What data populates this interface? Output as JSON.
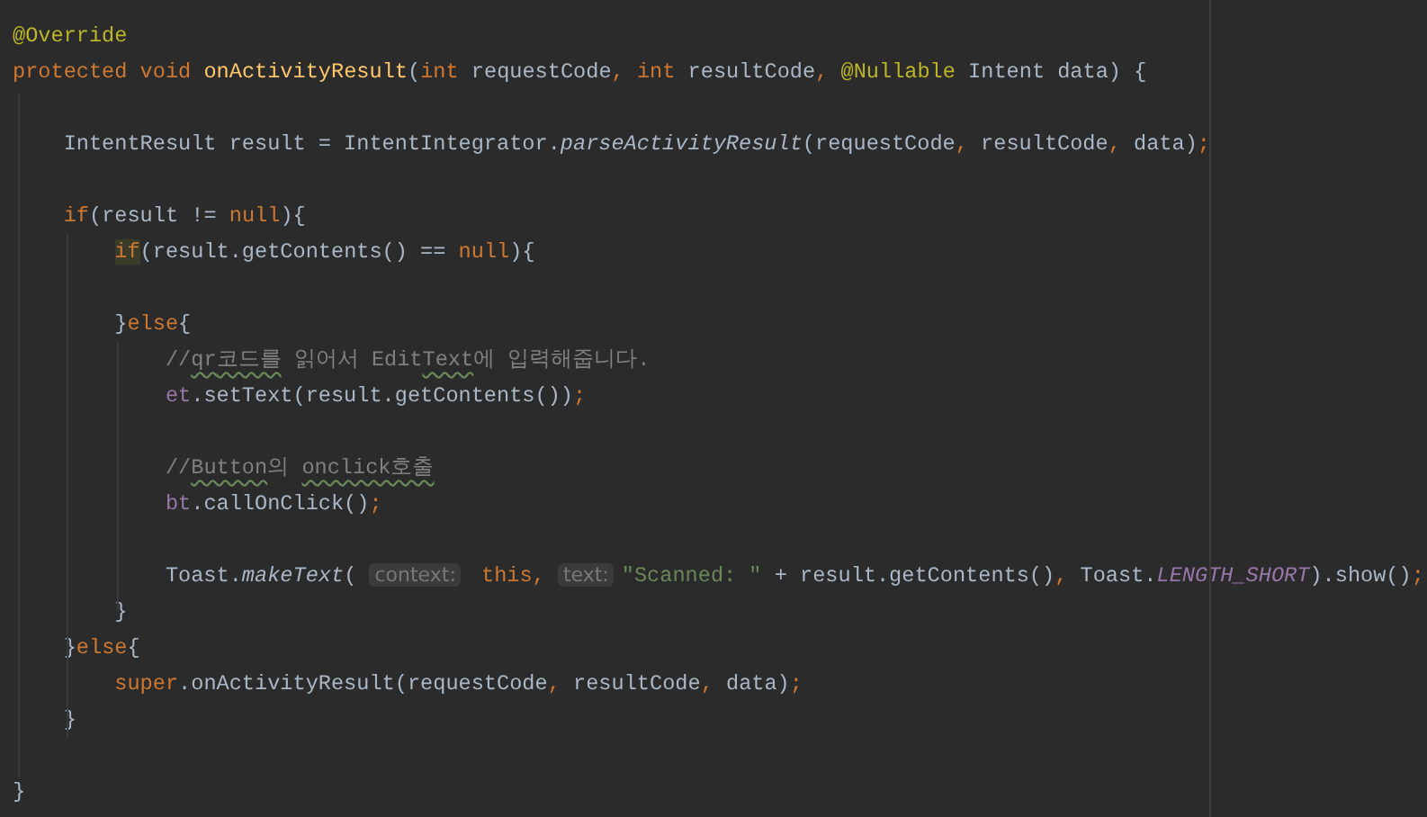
{
  "editor": {
    "lines": [
      {
        "kind": "code",
        "tokens": [
          {
            "t": "@Override",
            "kind": "annotation"
          }
        ]
      },
      {
        "kind": "code",
        "tokens": [
          {
            "t": "protected void ",
            "kind": "keyword"
          },
          {
            "t": "onActivityResult",
            "kind": "declaration"
          },
          {
            "t": "(",
            "kind": "plain"
          },
          {
            "t": "int ",
            "kind": "keyword"
          },
          {
            "t": "requestCode",
            "kind": "plain"
          },
          {
            "t": ", ",
            "kind": "keyword"
          },
          {
            "t": "int ",
            "kind": "keyword"
          },
          {
            "t": "resultCode",
            "kind": "plain"
          },
          {
            "t": ", ",
            "kind": "keyword"
          },
          {
            "t": "@Nullable ",
            "kind": "annotation"
          },
          {
            "t": "Intent data) {",
            "kind": "plain"
          }
        ],
        "children": [
          {
            "kind": "blank"
          },
          {
            "kind": "code",
            "tokens": [
              {
                "t": "IntentResult result = IntentIntegrator.",
                "kind": "plain"
              },
              {
                "t": "parseActivityResult",
                "kind": "static-method"
              },
              {
                "t": "(requestCode",
                "kind": "plain"
              },
              {
                "t": ", ",
                "kind": "keyword"
              },
              {
                "t": "resultCode",
                "kind": "plain"
              },
              {
                "t": ", ",
                "kind": "keyword"
              },
              {
                "t": "data)",
                "kind": "plain"
              },
              {
                "t": ";",
                "kind": "keyword"
              }
            ]
          },
          {
            "kind": "blank"
          },
          {
            "kind": "code",
            "tokens": [
              {
                "t": "if",
                "kind": "keyword"
              },
              {
                "t": "(result != ",
                "kind": "plain"
              },
              {
                "t": "null",
                "kind": "keyword"
              },
              {
                "t": "){",
                "kind": "plain"
              }
            ],
            "children": [
              {
                "kind": "code",
                "tokens": [
                  {
                    "t": "if",
                    "kind": "keyword-match"
                  },
                  {
                    "t": "(result.getContents() == ",
                    "kind": "plain"
                  },
                  {
                    "t": "null",
                    "kind": "keyword"
                  },
                  {
                    "t": "){",
                    "kind": "plain"
                  }
                ],
                "children": [
                  {
                    "kind": "blank"
                  }
                ]
              },
              {
                "kind": "code",
                "tokens": [
                  {
                    "t": "}",
                    "kind": "plain"
                  },
                  {
                    "t": "else",
                    "kind": "keyword"
                  },
                  {
                    "t": "{",
                    "kind": "plain"
                  }
                ],
                "children": [
                  {
                    "kind": "code",
                    "tokens": [
                      {
                        "t": "//",
                        "kind": "comment"
                      },
                      {
                        "t": "qr",
                        "kind": "comment-typo"
                      },
                      {
                        "t": "코드를",
                        "kind": "comment-typo"
                      },
                      {
                        "t": " 읽어서 Edit",
                        "kind": "comment"
                      },
                      {
                        "t": "Text",
                        "kind": "comment-typo"
                      },
                      {
                        "t": "에 입력해줍니다.",
                        "kind": "comment"
                      }
                    ]
                  },
                  {
                    "kind": "code",
                    "tokens": [
                      {
                        "t": "et",
                        "kind": "field"
                      },
                      {
                        "t": ".setText(result.getContents())",
                        "kind": "plain"
                      },
                      {
                        "t": ";",
                        "kind": "keyword"
                      }
                    ]
                  },
                  {
                    "kind": "blank"
                  },
                  {
                    "kind": "code",
                    "tokens": [
                      {
                        "t": "//",
                        "kind": "comment"
                      },
                      {
                        "t": "Button",
                        "kind": "comment-typo"
                      },
                      {
                        "t": "의 ",
                        "kind": "comment"
                      },
                      {
                        "t": "onclick호출",
                        "kind": "comment-typo"
                      }
                    ]
                  },
                  {
                    "kind": "code",
                    "tokens": [
                      {
                        "t": "bt",
                        "kind": "field"
                      },
                      {
                        "t": ".callOnClick()",
                        "kind": "plain"
                      },
                      {
                        "t": ";",
                        "kind": "keyword"
                      }
                    ]
                  },
                  {
                    "kind": "blank"
                  },
                  {
                    "kind": "code",
                    "tokens": [
                      {
                        "t": "Toast.",
                        "kind": "plain"
                      },
                      {
                        "t": "makeText",
                        "kind": "static-method"
                      },
                      {
                        "t": "( ",
                        "kind": "plain"
                      },
                      {
                        "t": "context:",
                        "kind": "hint"
                      },
                      {
                        "t": " this, ",
                        "kind": "keyword"
                      },
                      {
                        "t": "text:",
                        "kind": "hint"
                      },
                      {
                        "t": "\"Scanned: \"",
                        "kind": "string"
                      },
                      {
                        "t": " + result.getContents()",
                        "kind": "plain"
                      },
                      {
                        "t": ", ",
                        "kind": "keyword"
                      },
                      {
                        "t": "Toast.",
                        "kind": "plain"
                      },
                      {
                        "t": "LENGTH_SHORT",
                        "kind": "constant"
                      },
                      {
                        "t": ").show()",
                        "kind": "plain"
                      },
                      {
                        "t": ";",
                        "kind": "keyword"
                      }
                    ]
                  }
                ]
              },
              {
                "kind": "code",
                "tokens": [
                  {
                    "t": "}",
                    "kind": "plain"
                  }
                ]
              }
            ]
          },
          {
            "kind": "code",
            "tokens": [
              {
                "t": "}",
                "kind": "plain"
              },
              {
                "t": "else",
                "kind": "keyword"
              },
              {
                "t": "{",
                "kind": "plain"
              }
            ],
            "children": [
              {
                "kind": "code",
                "tokens": [
                  {
                    "t": "super",
                    "kind": "keyword"
                  },
                  {
                    "t": ".onActivityResult(requestCode",
                    "kind": "plain"
                  },
                  {
                    "t": ", ",
                    "kind": "keyword"
                  },
                  {
                    "t": "resultCode",
                    "kind": "plain"
                  },
                  {
                    "t": ", ",
                    "kind": "keyword"
                  },
                  {
                    "t": "data)",
                    "kind": "plain"
                  },
                  {
                    "t": ";",
                    "kind": "keyword"
                  }
                ]
              }
            ]
          },
          {
            "kind": "code",
            "tokens": [
              {
                "t": "}",
                "kind": "plain"
              }
            ]
          },
          {
            "kind": "blank"
          }
        ]
      },
      {
        "kind": "code",
        "tokens": [
          {
            "t": "}",
            "kind": "plain"
          }
        ]
      }
    ]
  }
}
